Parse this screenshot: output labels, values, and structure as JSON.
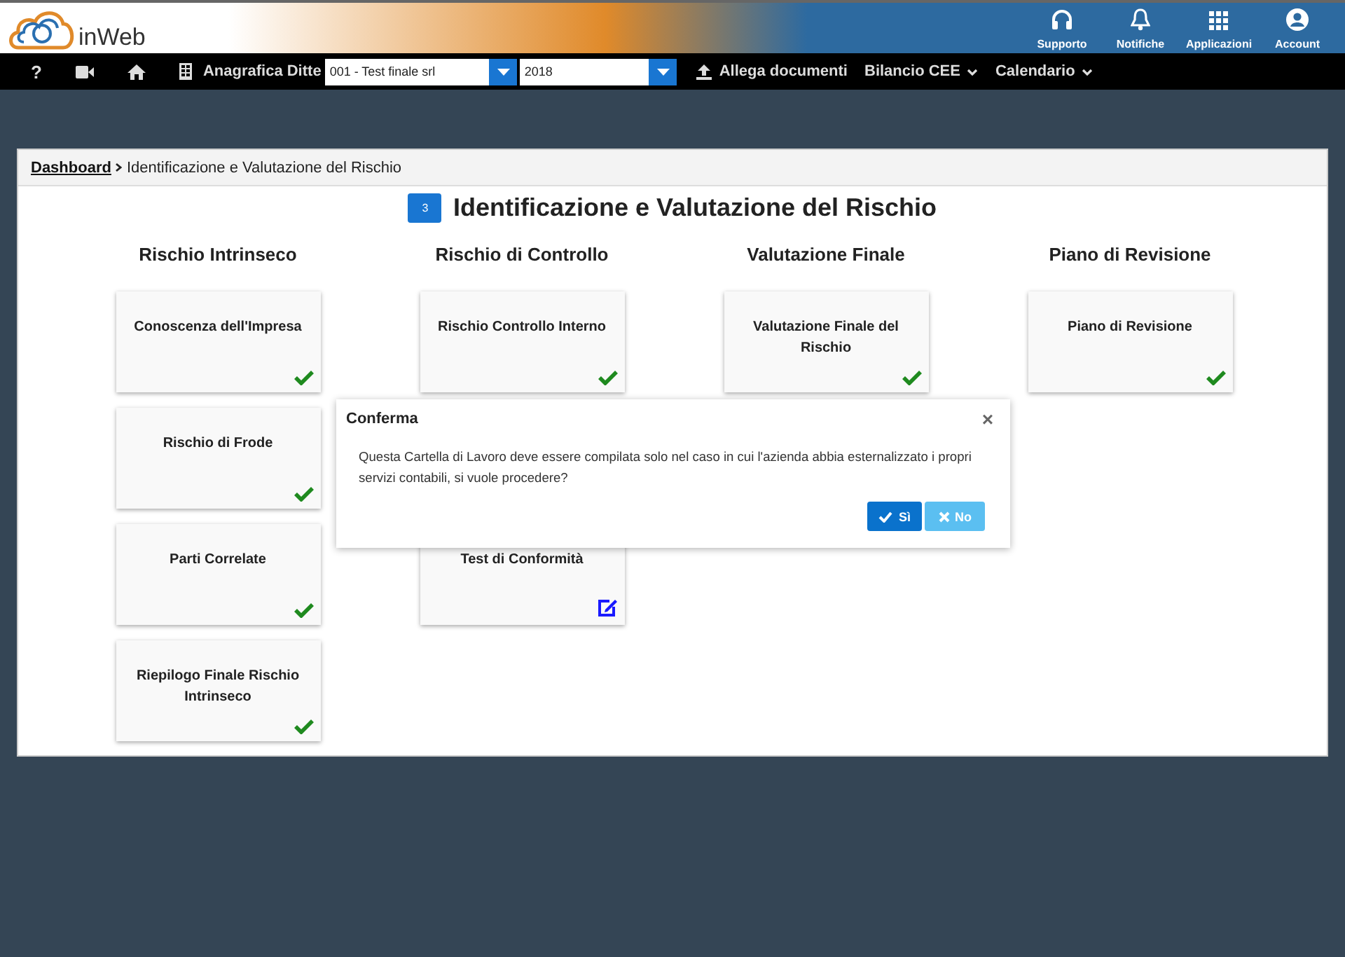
{
  "header": {
    "logo_text": "inWeb",
    "actions": [
      {
        "kind": "headset",
        "label": "Supporto"
      },
      {
        "kind": "bell",
        "label": "Notifiche"
      },
      {
        "kind": "grid",
        "label": "Applicazioni"
      },
      {
        "kind": "user",
        "label": "Account"
      }
    ]
  },
  "nav": {
    "help": "?",
    "company_label": "Anagrafica Ditte",
    "company_value": "001 - Test finale srl",
    "year_value": "2018",
    "upload_label": "Allega documenti",
    "menus": [
      "Bilancio CEE",
      "Calendario"
    ]
  },
  "breadcrumb": {
    "link": "Dashboard",
    "current": "Identificazione e Valutazione del Rischio"
  },
  "title": {
    "badge": "3",
    "text": "Identificazione e Valutazione del Rischio"
  },
  "columns": [
    {
      "heading": "Rischio Intrinseco",
      "cards": [
        {
          "label": "Conoscenza dell'Impresa",
          "completed": true
        },
        {
          "label": "Rischio di Frode",
          "completed": true
        },
        {
          "label": "Parti Correlate",
          "completed": true
        },
        {
          "label": "Riepilogo Finale Rischio Intrinseco",
          "completed": true
        }
      ]
    },
    {
      "heading": "Rischio di Controllo",
      "cards": [
        {
          "label": "Rischio Controllo Interno",
          "completed": true
        },
        {
          "label": "Test di Conformità",
          "completed": false
        }
      ]
    },
    {
      "heading": "Valutazione Finale",
      "cards": [
        {
          "label": "Valutazione Finale del Rischio",
          "completed": true
        }
      ]
    },
    {
      "heading": "Piano di Revisione",
      "cards": [
        {
          "label": "Piano di Revisione",
          "completed": true
        }
      ]
    }
  ],
  "dialog": {
    "title": "Conferma",
    "close": "×",
    "message": "Questa Cartella di Lavoro deve essere compilata solo nel caso in cui l'azienda abbia esternalizzato i propri servizi contabili, si vuole procedere?",
    "buttons": [
      {
        "label": "Sì",
        "kind": "yes"
      },
      {
        "label": "No",
        "kind": "no"
      }
    ]
  }
}
